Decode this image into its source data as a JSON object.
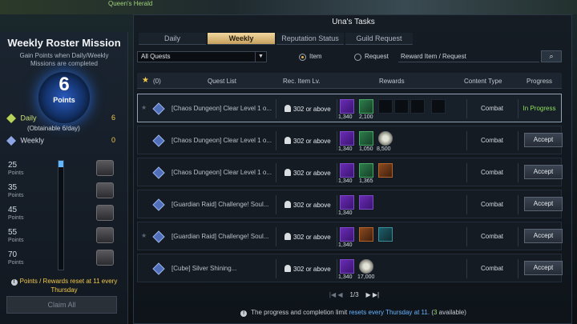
{
  "top": {
    "herald": "Queen's Herald"
  },
  "left": {
    "title": "Weekly Roster Mission",
    "subtitle": "Gain Points when Daily/Weekly Missions are completed",
    "points_value": "6",
    "points_label": "Points",
    "daily_label": "Daily",
    "daily_value": "6",
    "daily_sub": "(Obtainable 6/day)",
    "weekly_label": "Weekly",
    "weekly_value": "0",
    "tiers": [
      {
        "value": "25",
        "unit": "Points"
      },
      {
        "value": "35",
        "unit": "Points"
      },
      {
        "value": "45",
        "unit": "Points"
      },
      {
        "value": "55",
        "unit": "Points"
      },
      {
        "value": "70",
        "unit": "Points"
      }
    ],
    "reset_note": "Points / Rewards reset at 11 every Thursday",
    "claim_all": "Claim All"
  },
  "main": {
    "title": "Una's Tasks",
    "tabs": [
      "Daily",
      "Weekly",
      "Reputation Status",
      "Guild Request"
    ],
    "active_tab": "Weekly",
    "filter": "All Quests",
    "radio_item": "Item",
    "radio_request": "Request",
    "search_placeholder": "Reward Item / Request",
    "header": {
      "fav_count": "(0)",
      "quest_list": "Quest List",
      "rec_item_lv": "Rec. Item Lv.",
      "rewards": "Rewards",
      "content_type": "Content Type",
      "progress": "Progress"
    },
    "rows": [
      {
        "name": "[Chaos Dungeon] Clear Level 1 o...",
        "lv": "302 or above",
        "c1": "1,340",
        "c2": "2,100",
        "c3": "",
        "type": "Combat",
        "progress": "In Progress"
      },
      {
        "name": "[Chaos Dungeon] Clear Level 1 o...",
        "lv": "302 or above",
        "c1": "1,340",
        "c2": "1,050",
        "c3": "8,500",
        "type": "Combat",
        "progress": "Accept"
      },
      {
        "name": "[Chaos Dungeon] Clear Level 1 o...",
        "lv": "302 or above",
        "c1": "1,340",
        "c2": "1,365",
        "c3": "",
        "type": "Combat",
        "progress": "Accept"
      },
      {
        "name": "[Guardian Raid] Challenge! Soul...",
        "lv": "302 or above",
        "c1": "1,340",
        "c2": "",
        "c3": "",
        "type": "Combat",
        "progress": "Accept"
      },
      {
        "name": "[Guardian Raid] Challenge! Soul...",
        "lv": "302 or above",
        "c1": "1,340",
        "c2": "",
        "c3": "",
        "type": "Combat",
        "progress": "Accept"
      },
      {
        "name": "[Cube] Silver Shining...",
        "lv": "302 or above",
        "c1": "1,340",
        "c2": "17,000",
        "c3": "",
        "type": "Combat",
        "progress": "Accept"
      }
    ],
    "pager": "1/3",
    "note_pre": "The progress and completion limit",
    "note_hl": "resets every Thursday at 11.",
    "note_open": "(",
    "note_avail_num": "3",
    "note_avail_txt": "available)"
  }
}
